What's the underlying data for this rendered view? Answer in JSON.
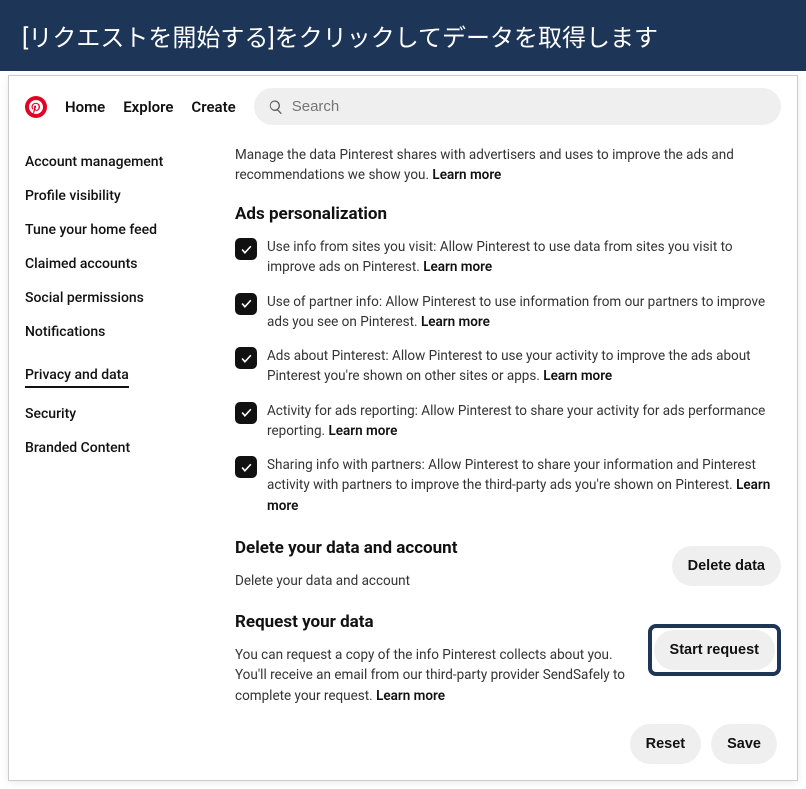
{
  "banner": {
    "text": "[リクエストを開始する]をクリックしてデータを取得します"
  },
  "nav": {
    "home": "Home",
    "explore": "Explore",
    "create": "Create"
  },
  "search": {
    "placeholder": "Search"
  },
  "sidebar": {
    "items": [
      {
        "label": "Account management",
        "active": false
      },
      {
        "label": "Profile visibility",
        "active": false
      },
      {
        "label": "Tune your home feed",
        "active": false
      },
      {
        "label": "Claimed accounts",
        "active": false
      },
      {
        "label": "Social permissions",
        "active": false
      },
      {
        "label": "Notifications",
        "active": false
      },
      {
        "label": "Privacy and data",
        "active": true
      },
      {
        "label": "Security",
        "active": false
      },
      {
        "label": "Branded Content",
        "active": false
      }
    ]
  },
  "main": {
    "intro": "Manage the data Pinterest shares with advertisers and uses to improve the ads and recommendations we show you.",
    "learn_more": "Learn more",
    "ads_title": "Ads personalization",
    "toggles": [
      {
        "text": "Use info from sites you visit: Allow Pinterest to use data from sites you visit to improve ads on Pinterest."
      },
      {
        "text": "Use of partner info: Allow Pinterest to use information from our partners to improve ads you see on Pinterest."
      },
      {
        "text": "Ads about Pinterest: Allow Pinterest to use your activity to improve the ads about Pinterest you're shown on other sites or apps."
      },
      {
        "text": "Activity for ads reporting: Allow Pinterest to share your activity for ads performance reporting."
      },
      {
        "text": "Sharing info with partners: Allow Pinterest to share your information and Pinterest activity with partners to improve the third-party ads you're shown on Pinterest."
      }
    ],
    "delete": {
      "title": "Delete your data and account",
      "desc": "Delete your data and account",
      "button": "Delete data"
    },
    "request": {
      "title": "Request your data",
      "desc": "You can request a copy of the info Pinterest collects about you. You'll receive an email from our third-party provider SendSafely to complete your request.",
      "button": "Start request"
    },
    "footer": {
      "reset": "Reset",
      "save": "Save"
    }
  }
}
